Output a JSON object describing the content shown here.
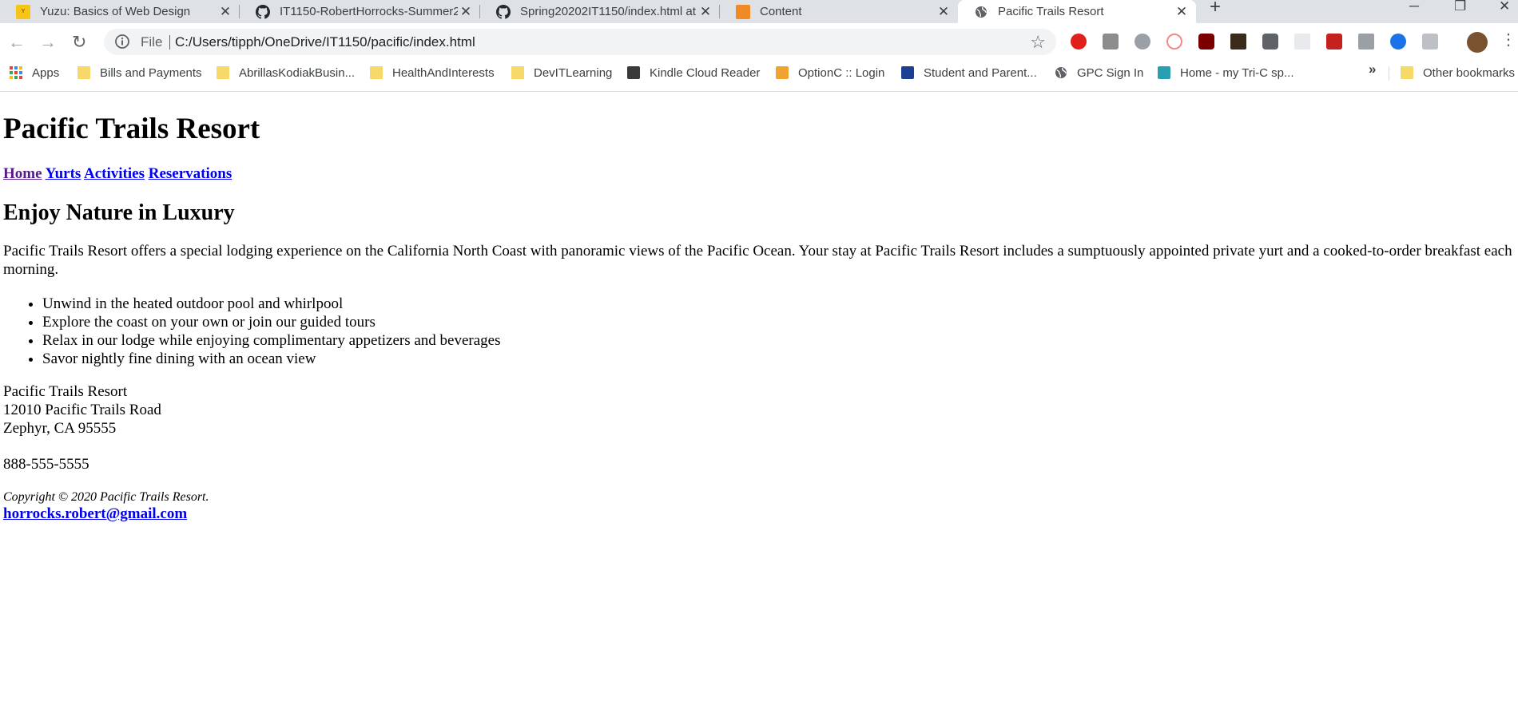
{
  "browser": {
    "tabs": [
      {
        "title": "Yuzu: Basics of Web Design",
        "icon": "yuzu-icon"
      },
      {
        "title": "IT1150-RobertHorrocks-Summer2",
        "icon": "github-icon"
      },
      {
        "title": "Spring20202IT1150/index.html at",
        "icon": "github-icon"
      },
      {
        "title": "Content",
        "icon": "content-icon"
      },
      {
        "title": "Pacific Trails Resort",
        "icon": "globe-icon"
      }
    ],
    "address": {
      "scheme": "File",
      "url": "C:/Users/tipph/OneDrive/IT1150/pacific/index.html"
    },
    "bookmarks": [
      {
        "label": "Apps",
        "icon": "apps-grid-icon"
      },
      {
        "label": "Bills and Payments",
        "icon": "folder-icon"
      },
      {
        "label": "AbrillasKodiakBusin...",
        "icon": "folder-icon"
      },
      {
        "label": "HealthAndInterests",
        "icon": "folder-icon"
      },
      {
        "label": "DevITLearning",
        "icon": "folder-icon"
      },
      {
        "label": "Kindle Cloud Reader",
        "icon": "kindle-icon"
      },
      {
        "label": "OptionC :: Login",
        "icon": "optionc-icon"
      },
      {
        "label": "Student and Parent...",
        "icon": "powerschool-icon"
      },
      {
        "label": "GPC Sign In",
        "icon": "globe-icon"
      },
      {
        "label": "Home - my Tri-C sp...",
        "icon": "tric-icon"
      }
    ],
    "overflow_label": "»",
    "other_bookmarks": "Other bookmarks"
  },
  "page": {
    "title": "Pacific Trails Resort",
    "nav": [
      "Home",
      "Yurts",
      "Activities",
      "Reservations"
    ],
    "heading": "Enjoy Nature in Luxury",
    "intro": "Pacific Trails Resort offers a special lodging experience on the California North Coast with panoramic views of the Pacific Ocean. Your stay at Pacific Trails Resort includes a sumptuously appointed private yurt and a cooked-to-order breakfast each morning.",
    "features": [
      "Unwind in the heated outdoor pool and whirlpool",
      "Explore the coast on your own or join our guided tours",
      "Relax in our lodge while enjoying complimentary appetizers and beverages",
      "Savor nightly fine dining with an ocean view"
    ],
    "contact": {
      "name": "Pacific Trails Resort",
      "street": "12010 Pacific Trails Road",
      "city": "Zephyr, CA 95555",
      "phone": "888-555-5555"
    },
    "copyright": "Copyright © 2020 Pacific Trails Resort.",
    "email": "horrocks.robert@gmail.com"
  }
}
